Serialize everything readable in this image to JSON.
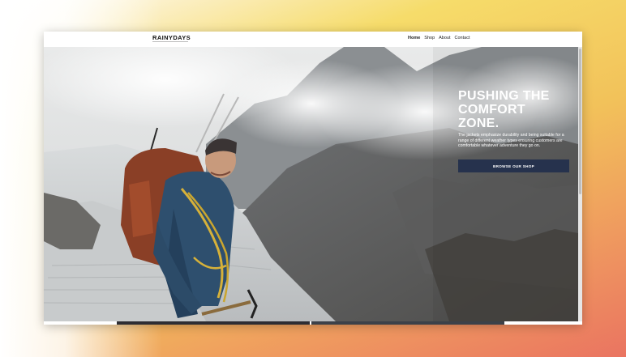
{
  "site": {
    "logo": "RAINYDAYS",
    "nav": [
      "Home",
      "Shop",
      "About",
      "Contact"
    ]
  },
  "hero": {
    "title_lines": [
      "PUSHING THE",
      "COMFORT",
      "ZONE."
    ],
    "text": "The jackets emphasize durability and being suitable for a range of different weather types ensuring customers are comfortable whatever adventure they go on.",
    "cta": "BROWSE OUR SHOP"
  },
  "colors": {
    "cta_background": "#26324d",
    "accent_gradient_top": "#f6dc6a",
    "accent_gradient_bottom": "#ea7461"
  }
}
